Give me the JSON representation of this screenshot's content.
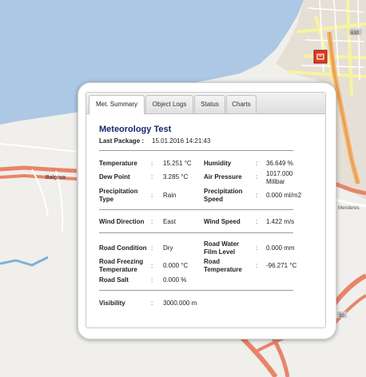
{
  "map": {
    "place_label": "Balçova",
    "road_label": "Menderes",
    "badge_top": "630",
    "badge_bottom": "30",
    "colors": {
      "sea": "#acc8e4",
      "land": "#f0efec",
      "urban": "#e6dfd5",
      "motorway": "#e8846a",
      "trunk": "#f4b26b",
      "road": "#ffffff",
      "yellow": "#f7f4a0",
      "marker": "#e23a1e"
    }
  },
  "popup": {
    "tabs": [
      {
        "label": "Met. Summary",
        "active": true
      },
      {
        "label": "Object Logs",
        "active": false
      },
      {
        "label": "Status",
        "active": false
      },
      {
        "label": "Charts",
        "active": false
      }
    ],
    "title": "Meteorology Test",
    "last_package": {
      "label": "Last Package :",
      "value": "15.01.2016 14:21:43"
    },
    "sep": ":",
    "fields": {
      "temperature": {
        "label": "Temperature",
        "value": "15.251 °C"
      },
      "humidity": {
        "label": "Humidity",
        "value": "36.649 %"
      },
      "dew_point": {
        "label": "Dew Point",
        "value": "3.285 °C"
      },
      "air_pressure": {
        "label": "Air Pressure",
        "value": "1017.000 Milibar"
      },
      "precip_type": {
        "label": "Precipitation Type",
        "value": "Rain"
      },
      "precip_speed": {
        "label": "Precipitation Speed",
        "value": "0.000 ml/m2"
      },
      "wind_direction": {
        "label": "Wind Direction",
        "value": "East"
      },
      "wind_speed": {
        "label": "Wind Speed",
        "value": "1.422 m/s"
      },
      "road_condition": {
        "label": "Road Condition",
        "value": "Dry"
      },
      "road_water": {
        "label": "Road Water Film Level",
        "value": "0.000 mm"
      },
      "road_freezing": {
        "label": "Road Freezing Temperature",
        "value": "0.000 °C"
      },
      "road_temperature": {
        "label": "Road Temperature",
        "value": "-96.271 °C"
      },
      "road_salt": {
        "label": "Road Salt",
        "value": "0.000 %"
      },
      "visibility": {
        "label": "Visibility",
        "value": "3000.000 m"
      }
    }
  }
}
